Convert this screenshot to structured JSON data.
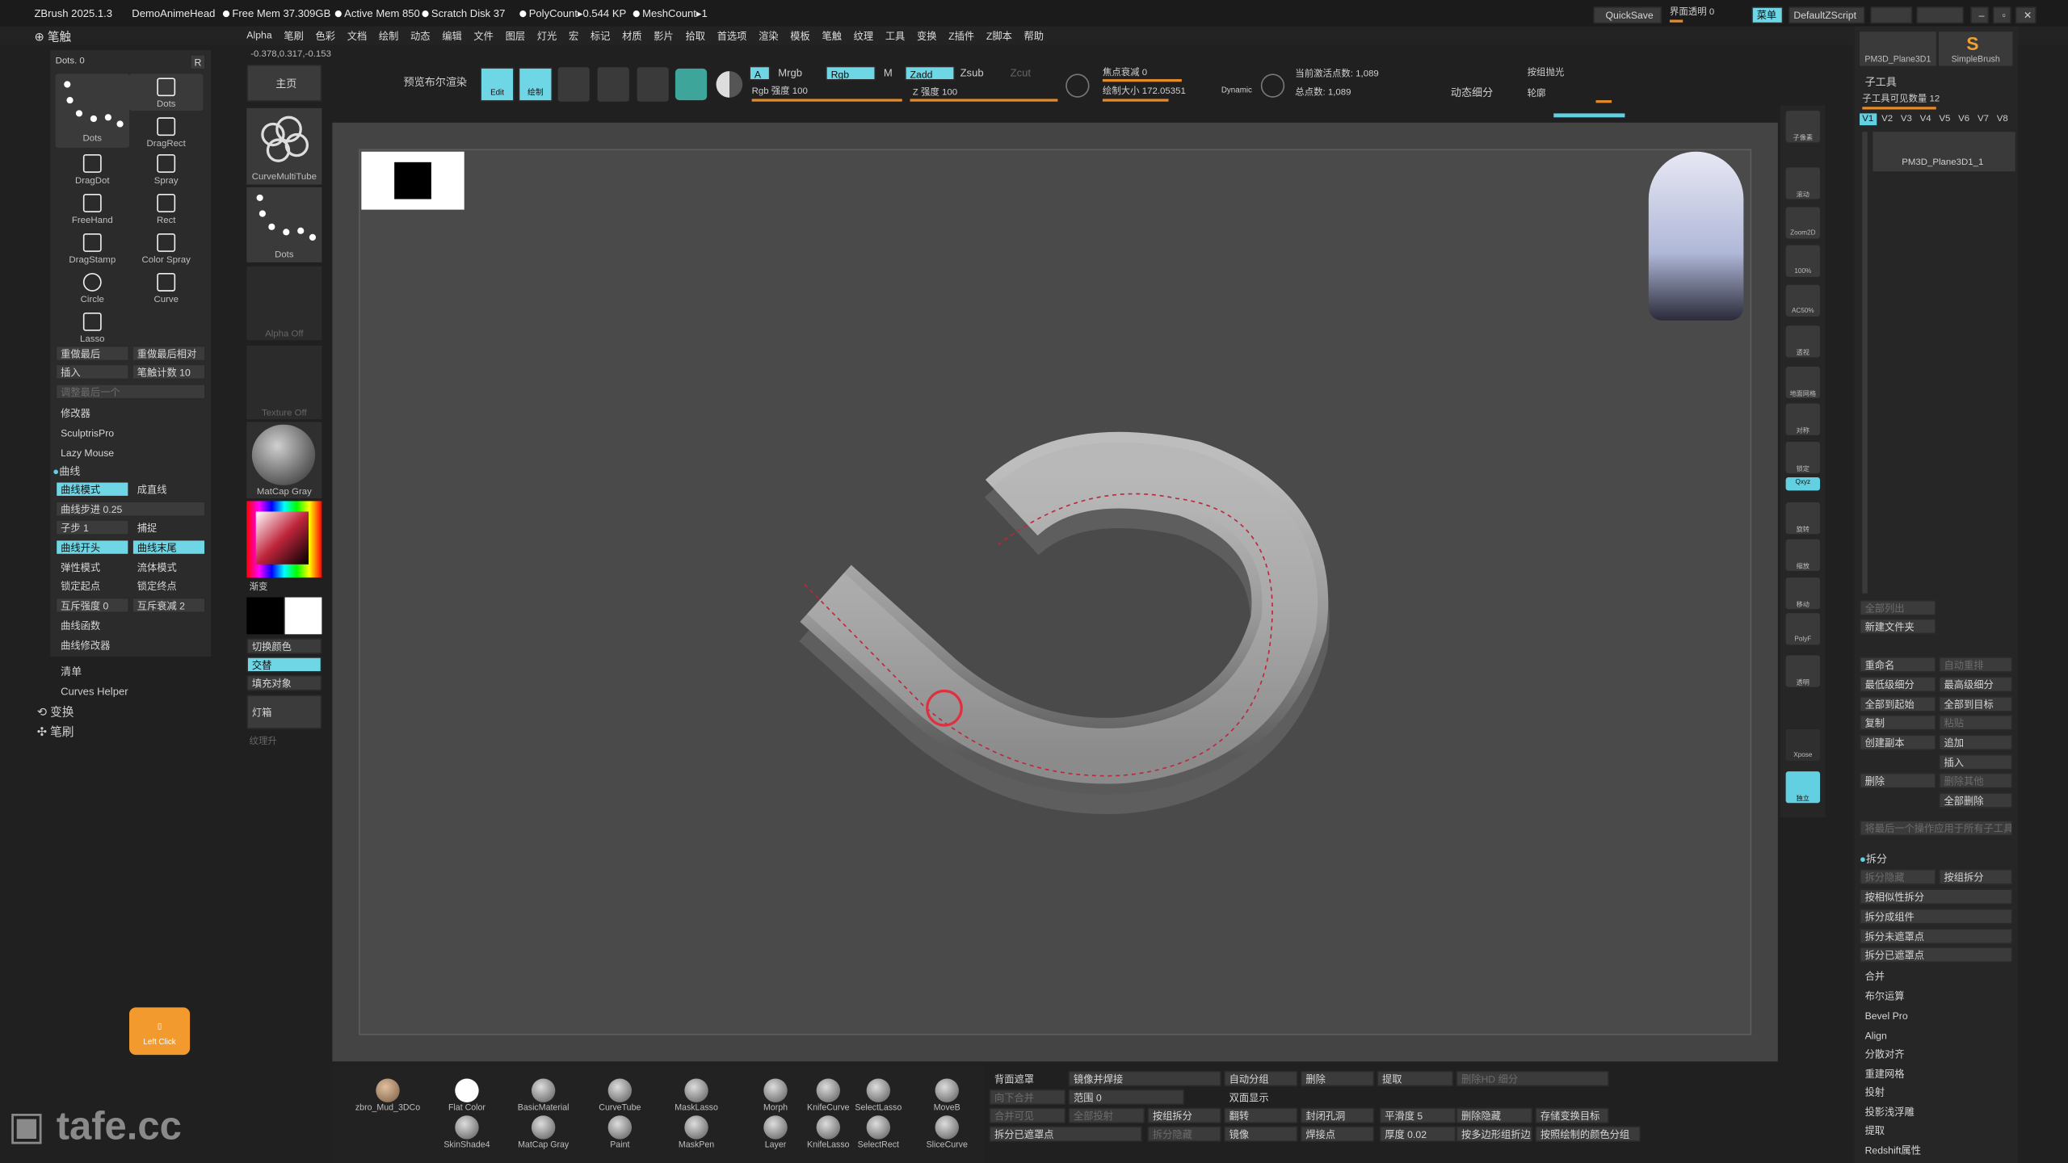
{
  "app": {
    "title": "ZBrush 2025.1.3",
    "doc": "DemoAnimeHead",
    "free_mem": "Free Mem 37.309GB",
    "active_mem": "Active Mem 850",
    "scratch": "Scratch Disk 37",
    "polycount": "PolyCount▸0.544 KP",
    "meshcount": "MeshCount▸1",
    "quicksave": "QuickSave",
    "ui_opacity": "界面透明 0",
    "menu_btn": "菜单",
    "default_zscript": "DefaultZScript",
    "coords": "-0.378,0.317,-0.153"
  },
  "menus": [
    "Alpha",
    "笔刷",
    "色彩",
    "文档",
    "绘制",
    "动态",
    "编辑",
    "文件",
    "图层",
    "灯光",
    "宏",
    "标记",
    "材质",
    "影片",
    "拾取",
    "首选项",
    "渲染",
    "模板",
    "笔触",
    "纹理",
    "工具",
    "变换",
    "Z插件",
    "Z脚本",
    "帮助"
  ],
  "left": {
    "header": "笔触",
    "dots_label": "Dots. 0",
    "r_btn": "R",
    "strokes": [
      {
        "name": "Dots",
        "label": "Dots"
      },
      {
        "name": "dots2",
        "label": "Dots"
      },
      {
        "name": "dragrect",
        "label": "DragRect"
      },
      {
        "name": "dragdot",
        "label": "DragDot"
      },
      {
        "name": "spray",
        "label": "Spray"
      },
      {
        "name": "freehand",
        "label": "FreeHand"
      },
      {
        "name": "rect",
        "label": "Rect"
      },
      {
        "name": "dragstamp",
        "label": "DragStamp"
      },
      {
        "name": "colorspray",
        "label": "Color Spray"
      },
      {
        "name": "circle",
        "label": "Circle"
      },
      {
        "name": "curve",
        "label": "Curve"
      },
      {
        "name": "lasso",
        "label": "Lasso"
      }
    ],
    "replay_last": "重做最后",
    "replay_last_rel": "重做最后相对",
    "insert": "插入",
    "stroke_count": "笔触计数 10",
    "modify_last": "调整最后一个",
    "modifier": "修改器",
    "sculptris": "SculptrisPro",
    "lazy_mouse": "Lazy Mouse",
    "curve_section": "曲线",
    "curve_mode": "曲线模式",
    "as_line": "成直线",
    "curve_step": "曲线步进 0.25",
    "sub_step": "子步 1",
    "snap": "捕捉",
    "curve_start": "曲线开头",
    "curve_end": "曲线末尾",
    "elastic": "弹性模式",
    "fluid": "流体模式",
    "lock_start": "锁定起点",
    "lock_end": "锁定终点",
    "mutual_intensity": "互斥强度 0",
    "mutual_decay": "互斥衰减 2",
    "curve_function": "曲线函数",
    "curve_modifier": "曲线修改器",
    "inventory": "清单",
    "curves_helper": "Curves Helper",
    "transform": "变换",
    "brush": "笔刷",
    "left_click": "Left Click"
  },
  "col2": {
    "home": "主页",
    "curve_multi_tube": "CurveMultiTube",
    "dots": "Dots",
    "alpha_off": "Alpha Off",
    "texture_off": "Texture Off",
    "matcap": "MatCap Gray",
    "gradient": "渐变",
    "switch_color": "切换颜色",
    "alternate": "交替",
    "fill_object": "填充对象",
    "lightbox": "灯箱",
    "texture_lift": "纹理升"
  },
  "top": {
    "preview_bool": "预览布尔渲染",
    "edit": "Edit",
    "draw": "绘制",
    "a_btn": "A",
    "mrgb": "Mrgb",
    "rgb": "Rgb",
    "m": "M",
    "zadd": "Zadd",
    "zsub": "Zsub",
    "zcut": "Zcut",
    "rgb_intensity": "Rgb 强度 100",
    "z_intensity": "Z 强度 100",
    "focal_shift": "焦点衰减 0",
    "draw_size": "绘制大小 172.05351",
    "dynamic": "Dynamic",
    "active_points": "当前激活点数: 1,089",
    "total_points": "总点数: 1,089",
    "dynamic_subdiv": "动态细分",
    "light_by_angle": "按组抛光",
    "contour": "轮廓"
  },
  "right": {
    "tool1": "PM3D_Plane3D1",
    "tool2": "SimpleBrush",
    "subtool_header": "子工具",
    "subtool_visible": "子工具可见数量 12",
    "versions": [
      "V1",
      "V2",
      "V3",
      "V4",
      "V5",
      "V6",
      "V7",
      "V8"
    ],
    "subtool_name": "PM3D_Plane3D1_1",
    "list_all": "全部列出",
    "new_folder": "新建文件夹",
    "rename": "重命名",
    "auto_reorder": "自动重排",
    "lowest_subdiv": "最低级细分",
    "highest_subdiv": "最高级细分",
    "all_to_start": "全部到起始",
    "all_to_target": "全部到目标",
    "copy": "复制",
    "paste": "粘贴",
    "create_copy": "创建副本",
    "append": "追加",
    "insert": "插入",
    "delete": "删除",
    "delete_other": "删除其他",
    "delete_all": "全部删除",
    "apply_last": "将最后一个操作应用于所有子工具",
    "split_section": "拆分",
    "split_hidden": "拆分隐藏",
    "split_groups": "按组拆分",
    "split_similar": "按相似性拆分",
    "split_parts": "拆分成组件",
    "split_unmasked": "拆分未遮罩点",
    "split_masked": "拆分已遮罩点",
    "merge": "合并",
    "boolean": "布尔运算",
    "bevel_pro": "Bevel Pro",
    "align": "Align",
    "distribute": "分散对齐",
    "remesh": "重建网格",
    "project": "投射",
    "project_bas": "投影浅浮雕",
    "extract": "提取",
    "redshift": "Redshift属性"
  },
  "shelf": {
    "rail_labels": [
      "子像素",
      "滚动",
      "Zoom2D",
      "100%",
      "AC50%",
      "透视",
      "地面网格",
      "对称",
      "锁定",
      "Qxyz",
      "旋转",
      "缩放",
      "移动",
      "PolyF",
      "透明",
      "Xpose",
      "独立"
    ]
  },
  "bottom": {
    "materials": [
      "zbro_Mud_3DCo",
      "Flat Color",
      "BasicMaterial",
      "CurveTube",
      "MaskLasso",
      "Morph",
      "KnifeCurve",
      "SelectLasso",
      "MoveB",
      "SkinShade4",
      "MatCap Gray",
      "Paint",
      "MaskPen",
      "Layer",
      "KnifeLasso",
      "SelectRect",
      "SliceCurve"
    ],
    "back_mask": "背面遮罩",
    "mirror_weld": "镜像并焊接",
    "auto_group": "自动分组",
    "delete": "删除",
    "extract": "提取",
    "del_hd": "删除HD 细分",
    "merge_down": "向下合并",
    "range": "范围 0",
    "double_side": "双面显示",
    "merge_visible": "合并可见",
    "all_visible": "全部投射",
    "split_groups": "按组拆分",
    "flip": "翻转",
    "close_holes": "封闭孔洞",
    "smooth": "平滑度 5",
    "del_hidden": "删除隐藏",
    "store_morph": "存储变换目标",
    "split_masked": "拆分已遮罩点",
    "split_hidden": "拆分隐藏",
    "mirror": "镜像",
    "weld_points": "焊接点",
    "thickness": "厚度 0.02",
    "poly_edge": "按多边形组折边",
    "polypaint_groups": "按照绘制的颜色分组"
  },
  "watermark": "tafe.cc",
  "colors": {
    "accent": "#62d0e0",
    "slider": "#e58a2a",
    "canvas": "#4a4a4a",
    "panel": "#2a2a2a"
  }
}
